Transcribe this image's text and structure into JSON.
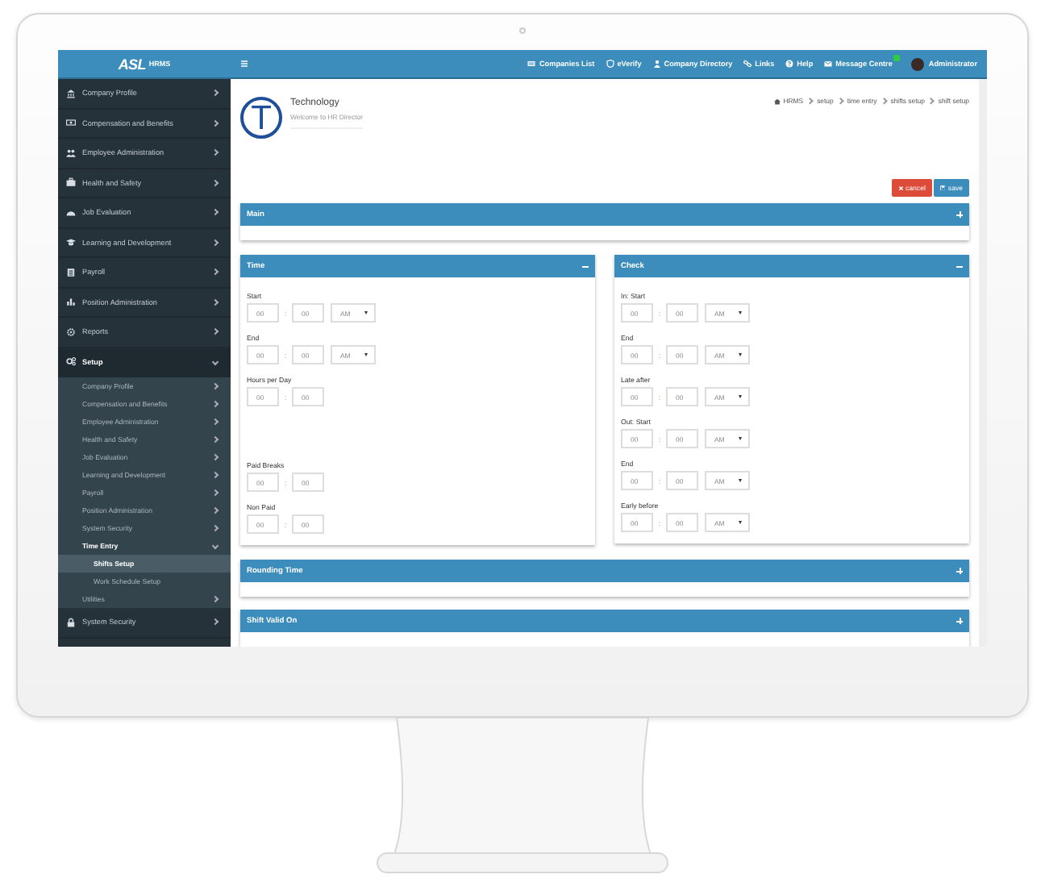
{
  "brand": {
    "logo": "ASL",
    "product": "HRMS"
  },
  "topbar": {
    "links": [
      {
        "label": "Companies List",
        "notification": false
      },
      {
        "label": "eVerify",
        "notification": false
      },
      {
        "label": "Company Directory",
        "notification": false
      },
      {
        "label": "Links",
        "notification": false
      },
      {
        "label": "Help",
        "notification": false
      },
      {
        "label": "Message Centre",
        "notification": true
      }
    ],
    "user": "Administrator"
  },
  "sidebar": {
    "items": [
      {
        "label": "Company Profile",
        "expanded": false,
        "selected": false
      },
      {
        "label": "Compensation and Benefits",
        "expanded": false,
        "selected": false
      },
      {
        "label": "Employee Administration",
        "expanded": false,
        "selected": false
      },
      {
        "label": "Health and Safety",
        "expanded": false,
        "selected": false
      },
      {
        "label": "Job Evaluation",
        "expanded": false,
        "selected": false
      },
      {
        "label": "Learning and Development",
        "expanded": false,
        "selected": false
      },
      {
        "label": "Payroll",
        "expanded": false,
        "selected": false
      },
      {
        "label": "Position Administration",
        "expanded": false,
        "selected": false
      },
      {
        "label": "Reports",
        "expanded": false,
        "selected": false
      },
      {
        "label": "Setup",
        "expanded": true,
        "selected": false,
        "children": [
          {
            "label": "Company Profile",
            "expanded": false,
            "selected": false
          },
          {
            "label": "Compensation and Benefits",
            "expanded": false,
            "selected": false
          },
          {
            "label": "Employee Administration",
            "expanded": false,
            "selected": false
          },
          {
            "label": "Health and Safety",
            "expanded": false,
            "selected": false
          },
          {
            "label": "Job Evaluation",
            "expanded": false,
            "selected": false
          },
          {
            "label": "Learning and Development",
            "expanded": false,
            "selected": false
          },
          {
            "label": "Payroll",
            "expanded": false,
            "selected": false
          },
          {
            "label": "Position Administration",
            "expanded": false,
            "selected": false
          },
          {
            "label": "System Security",
            "expanded": false,
            "selected": false
          },
          {
            "label": "Time Entry",
            "expanded": true,
            "selected": false,
            "children": [
              {
                "label": "Shifts Setup",
                "selected": true
              },
              {
                "label": "Work Schedule Setup",
                "selected": false
              }
            ]
          },
          {
            "label": "Utilities",
            "expanded": false,
            "selected": false
          }
        ]
      },
      {
        "label": "System Security",
        "expanded": false,
        "selected": false
      }
    ]
  },
  "header": {
    "initial": "T",
    "company": "Technology",
    "subtitle": "Welcome to HR Director",
    "breadcrumb": [
      "HRMS",
      "setup",
      "time entry",
      "shifts setup",
      "shift setup"
    ]
  },
  "actions": [
    {
      "kind": "cancel",
      "label": "cancel"
    },
    {
      "kind": "save",
      "label": "save"
    }
  ],
  "main_panel": {
    "title": "Main",
    "expanded": false
  },
  "form_panels": [
    {
      "title": "Time",
      "expanded": true,
      "fields": [
        {
          "label": "Start",
          "hours": "00",
          "separator": ":",
          "minutes": "00",
          "period": "AM",
          "spaced": false
        },
        {
          "label": "End",
          "hours": "00",
          "separator": ":",
          "minutes": "00",
          "period": "AM",
          "spaced": false
        },
        {
          "label": "Hours per Day",
          "hours": "00",
          "separator": ":",
          "minutes": "00",
          "spaced": false
        },
        {
          "label": "Paid Breaks",
          "hours": "00",
          "separator": ":",
          "minutes": "00",
          "spaced": true
        },
        {
          "label": "Non Paid",
          "hours": "00",
          "separator": ":",
          "minutes": "00",
          "spaced": false
        }
      ]
    },
    {
      "title": "Check",
      "expanded": true,
      "fields": [
        {
          "label": "In: Start",
          "hours": "00",
          "separator": ":",
          "minutes": "00",
          "period": "AM",
          "spaced": false
        },
        {
          "label": "End",
          "hours": "00",
          "separator": ":",
          "minutes": "00",
          "period": "AM",
          "spaced": false
        },
        {
          "label": "Late after",
          "hours": "00",
          "separator": ":",
          "minutes": "00",
          "period": "AM",
          "spaced": false
        },
        {
          "label": "Out: Start",
          "hours": "00",
          "separator": ":",
          "minutes": "00",
          "period": "AM",
          "spaced": false
        },
        {
          "label": "End",
          "hours": "00",
          "separator": ":",
          "minutes": "00",
          "period": "AM",
          "spaced": false
        },
        {
          "label": "Early before",
          "hours": "00",
          "separator": ":",
          "minutes": "00",
          "period": "AM",
          "spaced": false
        }
      ]
    }
  ],
  "lower_panels": [
    {
      "title": "Rounding Time",
      "expanded": false
    },
    {
      "title": "Shift Valid On",
      "expanded": false
    }
  ]
}
